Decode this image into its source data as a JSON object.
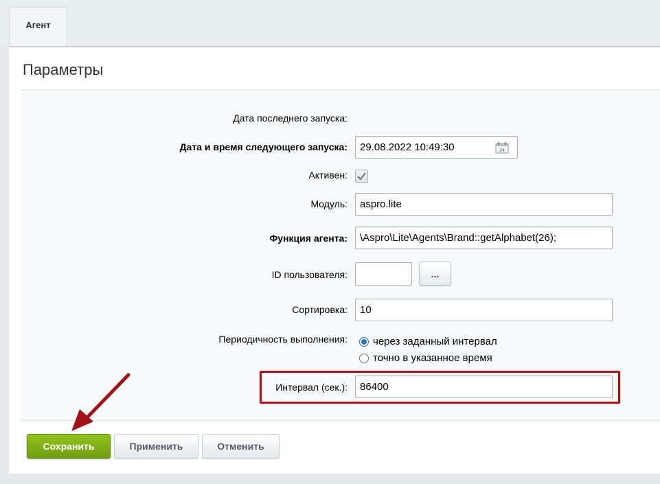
{
  "tabs": [
    {
      "label": "Агент"
    }
  ],
  "panel": {
    "title": "Параметры"
  },
  "form": {
    "last_run_label": "Дата последнего запуска:",
    "next_run_label": "Дата и время следующего запуска:",
    "next_run_value": "29.08.2022 10:49:30",
    "active_label": "Активен:",
    "active_checked": true,
    "module_label": "Модуль:",
    "module_value": "aspro.lite",
    "function_label": "Функция агента:",
    "function_value": "\\Aspro\\Lite\\Agents\\Brand::getAlphabet(26);",
    "user_id_label": "ID пользователя:",
    "user_id_value": "",
    "user_picker_label": "...",
    "sort_label": "Сортировка:",
    "sort_value": "10",
    "periodicity_label": "Периодичность выполнения:",
    "periodicity_options": [
      {
        "label": "через заданный интервал",
        "checked": true
      },
      {
        "label": "точно в указанное время",
        "checked": false
      }
    ],
    "interval_label": "Интервал (сек.):",
    "interval_value": "86400"
  },
  "buttons": {
    "save": "Сохранить",
    "apply": "Применить",
    "cancel": "Отменить"
  },
  "annotations": {
    "highlight_color": "#a31018",
    "arrow_color": "#a31018"
  }
}
